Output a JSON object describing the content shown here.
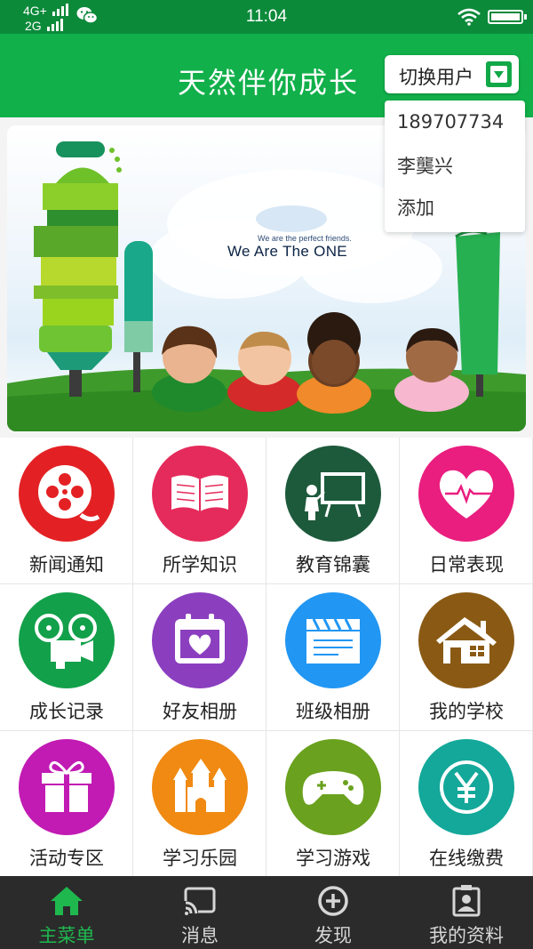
{
  "status_bar": {
    "network_top": "4G+",
    "network_bottom": "2G",
    "time": "11:04",
    "icons": [
      "signal-icon",
      "wechat-icon",
      "wifi-icon",
      "battery-icon"
    ]
  },
  "header": {
    "title": "天然伴你成长",
    "switch_user_label": "切换用户",
    "switch_icon": "chevron-down-icon"
  },
  "user_dropdown": {
    "options": [
      "189707734",
      "李龑兴",
      "添加"
    ]
  },
  "banner": {
    "tagline": "We are the perfect friends.",
    "headline": "We Are The ONE"
  },
  "menu": {
    "items": [
      {
        "label": "新闻通知",
        "icon": "film-reel-icon",
        "color": "#e32124"
      },
      {
        "label": "所学知识",
        "icon": "open-book-icon",
        "color": "#e52b5b"
      },
      {
        "label": "教育锦囊",
        "icon": "teacher-board-icon",
        "color": "#1d5a3c"
      },
      {
        "label": "日常表现",
        "icon": "heart-pulse-icon",
        "color": "#e91e7f"
      },
      {
        "label": "成长记录",
        "icon": "movie-projector-icon",
        "color": "#12a04a"
      },
      {
        "label": "好友相册",
        "icon": "calendar-heart-icon",
        "color": "#8b3fbf"
      },
      {
        "label": "班级相册",
        "icon": "clapperboard-icon",
        "color": "#2196f3"
      },
      {
        "label": "我的学校",
        "icon": "house-icon",
        "color": "#8a5a14"
      },
      {
        "label": "活动专区",
        "icon": "gift-box-icon",
        "color": "#c11bb3"
      },
      {
        "label": "学习乐园",
        "icon": "castle-icon",
        "color": "#f08a12"
      },
      {
        "label": "学习游戏",
        "icon": "gamepad-icon",
        "color": "#6aa11e"
      },
      {
        "label": "在线缴费",
        "icon": "yen-coin-icon",
        "color": "#13a89a"
      }
    ]
  },
  "tab_bar": {
    "tabs": [
      {
        "label": "主菜单",
        "icon": "home-icon",
        "active": true
      },
      {
        "label": "消息",
        "icon": "cast-icon",
        "active": false
      },
      {
        "label": "发现",
        "icon": "plus-circle-icon",
        "active": false
      },
      {
        "label": "我的资料",
        "icon": "profile-card-icon",
        "active": false
      }
    ],
    "active_color": "#1fb84f"
  }
}
